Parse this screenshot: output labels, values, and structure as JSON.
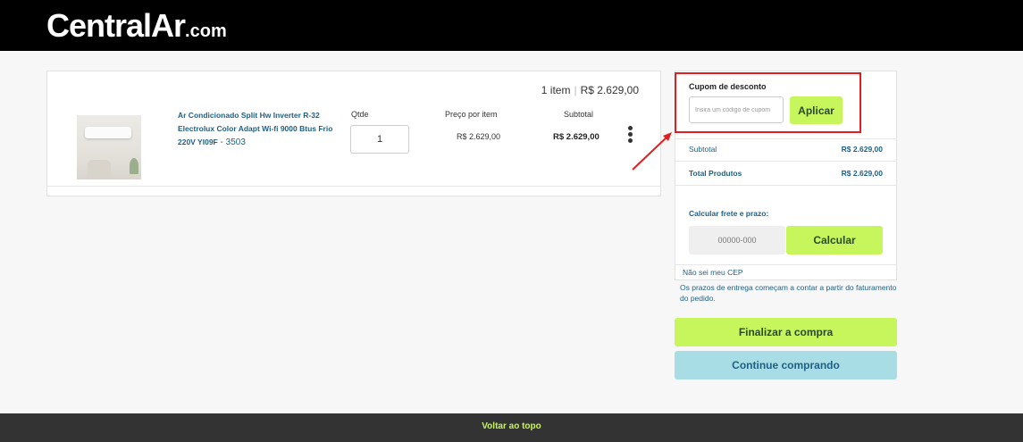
{
  "header": {
    "logo_main": "CentralAr",
    "logo_sub": ".com"
  },
  "cart": {
    "item_count": "1 item",
    "total": "R$ 2.629,00",
    "columns": {
      "qty": "Qtde",
      "unit_price": "Preço por item",
      "subtotal": "Subtotal"
    },
    "item": {
      "name": "Ar Condicionado Split Hw Inverter R-32 Electrolux Color Adapt Wi-fi 9000 Btus Frio 220V YI09F",
      "sku": " - 3503",
      "qty": "1",
      "unit_price": "R$ 2.629,00",
      "subtotal": "R$ 2.629,00"
    }
  },
  "sidebar": {
    "coupon": {
      "title": "Cupom de desconto",
      "placeholder": "Insira um código de cupom",
      "apply_label": "Aplicar"
    },
    "subtotal_label": "Subtotal",
    "subtotal_value": "R$ 2.629,00",
    "total_label": "Total Produtos",
    "total_value": "R$ 2.629,00",
    "shipping": {
      "title": "Calcular frete e prazo:",
      "placeholder": "00000-000",
      "calc_label": "Calcular",
      "no_cep": "Não sei meu CEP"
    },
    "notice": "Os prazos de entrega começam a contar a partir do faturamento do pedido.",
    "finish_label": "Finalizar a compra",
    "continue_label": "Continue comprando"
  },
  "footer": {
    "back_to_top": "Voltar ao topo"
  },
  "colors": {
    "accent_green": "#c6f55c",
    "accent_blue": "#a8dde6",
    "link_blue": "#1f5f83",
    "highlight_red": "#e02020"
  }
}
